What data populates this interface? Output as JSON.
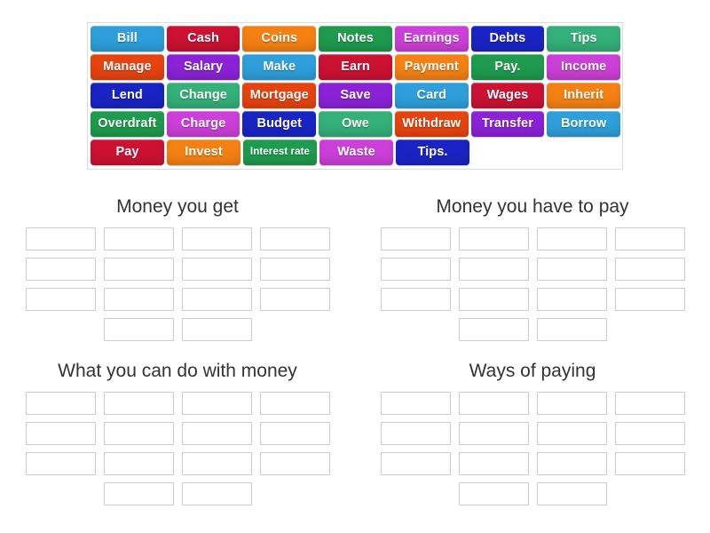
{
  "activity": {
    "type": "group-sort",
    "word_bank": {
      "rows": [
        [
          {
            "label": "Bill",
            "color": "#2e9fda"
          },
          {
            "label": "Cash",
            "color": "#cc1133"
          },
          {
            "label": "Coins",
            "color": "#f58113"
          },
          {
            "label": "Notes",
            "color": "#1e9b4e"
          },
          {
            "label": "Earnings",
            "color": "#cc3fd8"
          },
          {
            "label": "Debts",
            "color": "#1a24c4"
          },
          {
            "label": "Tips",
            "color": "#34b07a"
          }
        ],
        [
          {
            "label": "Manage",
            "color": "#e8430f"
          },
          {
            "label": "Salary",
            "color": "#8b22d8"
          },
          {
            "label": "Make",
            "color": "#2e9fda"
          },
          {
            "label": "Earn",
            "color": "#cc1133"
          },
          {
            "label": "Payment",
            "color": "#f58113"
          },
          {
            "label": "Pay.",
            "color": "#1e9b4e"
          },
          {
            "label": "Income",
            "color": "#cc3fd8"
          }
        ],
        [
          {
            "label": "Lend",
            "color": "#1a24c4"
          },
          {
            "label": "Change",
            "color": "#34b07a"
          },
          {
            "label": "Mortgage",
            "color": "#e8430f"
          },
          {
            "label": "Save",
            "color": "#8b22d8"
          },
          {
            "label": "Card",
            "color": "#2e9fda"
          },
          {
            "label": "Wages",
            "color": "#cc1133"
          },
          {
            "label": "Inherit",
            "color": "#f58113"
          }
        ],
        [
          {
            "label": "Overdraft",
            "color": "#1e9b4e"
          },
          {
            "label": "Charge",
            "color": "#cc3fd8"
          },
          {
            "label": "Budget",
            "color": "#1a24c4"
          },
          {
            "label": "Owe",
            "color": "#34b07a"
          },
          {
            "label": "Withdraw",
            "color": "#e8430f"
          },
          {
            "label": "Transfer",
            "color": "#8b22d8"
          },
          {
            "label": "Borrow",
            "color": "#2e9fda"
          }
        ],
        [
          {
            "label": "Pay",
            "color": "#cc1133"
          },
          {
            "label": "Invest",
            "color": "#f58113"
          },
          {
            "label": "Interest rate",
            "color": "#1e9b4e",
            "small": true
          },
          {
            "label": "Waste",
            "color": "#cc3fd8"
          },
          {
            "label": "Tips.",
            "color": "#1a24c4"
          }
        ]
      ]
    },
    "categories": [
      {
        "title": "Money you get",
        "rows": [
          4,
          4,
          4,
          2
        ]
      },
      {
        "title": "Money you have to pay",
        "rows": [
          4,
          4,
          4,
          2
        ]
      },
      {
        "title": "What you can do with money",
        "rows": [
          4,
          4,
          4,
          2
        ]
      },
      {
        "title": "Ways of paying",
        "rows": [
          4,
          4,
          4,
          2
        ]
      }
    ]
  }
}
